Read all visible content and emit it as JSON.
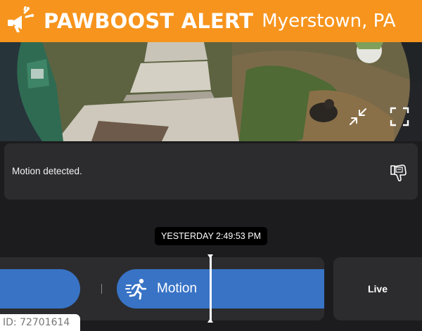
{
  "banner": {
    "brand": "PAWBOOST ALERT",
    "location": "Myerstown, PA",
    "icon": "megaphone-icon",
    "color": "#f7941d"
  },
  "camera": {
    "controls": [
      "exit-fullscreen-icon",
      "fullscreen-icon"
    ]
  },
  "event": {
    "text": "Motion detected.",
    "feedback_icon": "thumbs-down-feedback-icon"
  },
  "timeline": {
    "timestamp": "YESTERDAY 2:49:53 PM",
    "clip_label": "Motion",
    "clip_icon": "running-person-icon",
    "live_label": "Live",
    "accent": "#3873c6"
  },
  "footer": {
    "id_label": "ID: 72701614"
  }
}
